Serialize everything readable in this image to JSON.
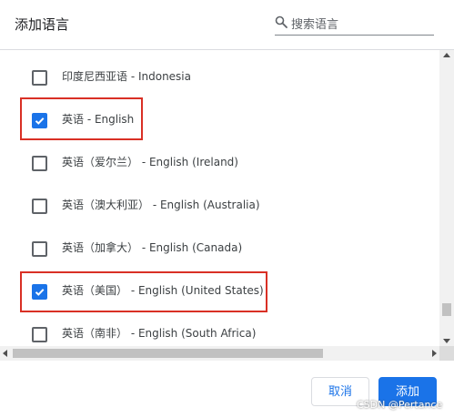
{
  "dialog": {
    "title": "添加语言",
    "search": {
      "placeholder": "搜索语言",
      "icon": "search-icon"
    }
  },
  "languages": [
    {
      "label": "印度尼西亚语 - Indonesia",
      "checked": false
    },
    {
      "label": "英语 - English",
      "checked": true
    },
    {
      "label": "英语（爱尔兰） - English (Ireland)",
      "checked": false
    },
    {
      "label": "英语（澳大利亚） - English (Australia)",
      "checked": false
    },
    {
      "label": "英语（加拿大） - English (Canada)",
      "checked": false
    },
    {
      "label": "英语（美国） - English (United States)",
      "checked": true
    },
    {
      "label": "英语（南非） - English (South Africa)",
      "checked": false
    }
  ],
  "buttons": {
    "cancel": "取消",
    "add": "添加"
  },
  "watermark": "CSDN @Pertance",
  "colors": {
    "accent": "#1a73e8",
    "highlight": "#d93025"
  }
}
